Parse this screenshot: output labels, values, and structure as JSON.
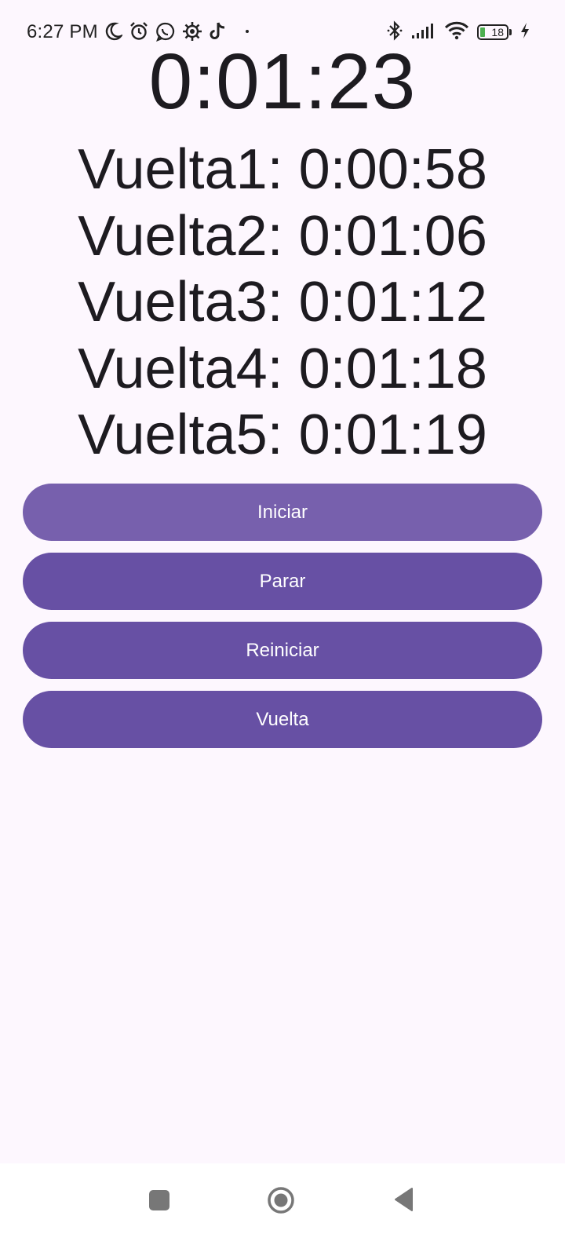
{
  "status_bar": {
    "time": "6:27 PM",
    "battery_level": "18",
    "left_icons": [
      "moon-icon",
      "alarm-icon",
      "whatsapp-icon",
      "settings-gear-icon",
      "tiktok-icon",
      "dot-icon"
    ],
    "right_icons": [
      "bluetooth-icon",
      "signal-icon",
      "wifi-icon",
      "battery-icon",
      "charging-icon"
    ],
    "battery_fill_fraction": 0.18,
    "battery_fill_color": "#4caf50"
  },
  "stopwatch": {
    "elapsed": "0:01:23"
  },
  "laps": [
    {
      "label": "Vuelta1: 0:00:58"
    },
    {
      "label": "Vuelta2: 0:01:06"
    },
    {
      "label": "Vuelta3: 0:01:12"
    },
    {
      "label": "Vuelta4: 0:01:18"
    },
    {
      "label": "Vuelta5: 0:01:19"
    }
  ],
  "buttons": {
    "start": "Iniciar",
    "stop": "Parar",
    "reset": "Reiniciar",
    "lap": "Vuelta"
  },
  "colors": {
    "background": "#fdf7fe",
    "button": "#6750a4",
    "button_pressed": "#7760ad",
    "button_text": "#ffffff"
  },
  "nav_bar": {
    "icons": [
      "recents-icon",
      "home-icon",
      "back-icon"
    ]
  }
}
